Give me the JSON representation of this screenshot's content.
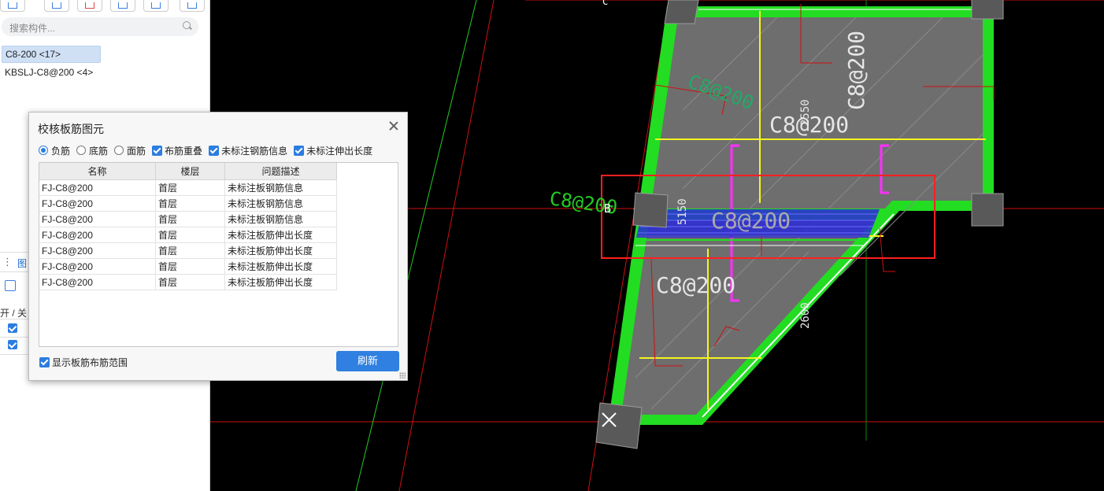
{
  "left_panel": {
    "search_placeholder": "搜索构件...",
    "component_items": [
      "C8-200 <17>",
      "KBSLJ-C8@200 <4>"
    ],
    "side_tab_label": "图",
    "onoff_label": "开 / 关"
  },
  "dialog": {
    "title": "校核板筋图元",
    "radio_options": [
      {
        "label": "负筋",
        "checked": true
      },
      {
        "label": "底筋",
        "checked": false
      },
      {
        "label": "面筋",
        "checked": false
      }
    ],
    "check_options": [
      "布筋重叠",
      "未标注钢筋信息",
      "未标注伸出长度"
    ],
    "table": {
      "headers": [
        "名称",
        "楼层",
        "问题描述"
      ],
      "rows": [
        [
          "FJ-C8@200",
          "首层",
          "未标注板钢筋信息"
        ],
        [
          "FJ-C8@200",
          "首层",
          "未标注板钢筋信息"
        ],
        [
          "FJ-C8@200",
          "首层",
          "未标注板钢筋信息"
        ],
        [
          "FJ-C8@200",
          "首层",
          "未标注板筋伸出长度"
        ],
        [
          "FJ-C8@200",
          "首层",
          "未标注板筋伸出长度"
        ],
        [
          "FJ-C8@200",
          "首层",
          "未标注板筋伸出长度"
        ],
        [
          "FJ-C8@200",
          "首层",
          "未标注板筋伸出长度"
        ]
      ]
    },
    "show_range_label": "显示板筋布筋范围",
    "refresh_label": "刷新"
  },
  "canvas": {
    "labels": {
      "c8_main": "C8@200",
      "c8_left": "C8@200",
      "c8_mid": "C8@200",
      "c8_bottom": "C8@200",
      "c8_right_vert": "C8@200",
      "c8_center_vert": "C8@200",
      "dim_5150": "5150",
      "dim_2550": "2550",
      "dim_2600": "2600",
      "axis_b": "B",
      "axis_c": "C"
    },
    "colors": {
      "background": "#000000",
      "slab": "#6e6e6e",
      "beam": "#22dd22",
      "rebar_yellow": "#f5f520",
      "rebar_magenta": "#ff30ff",
      "highlight": "#2a2ad8",
      "selection": "#ff2020"
    }
  }
}
